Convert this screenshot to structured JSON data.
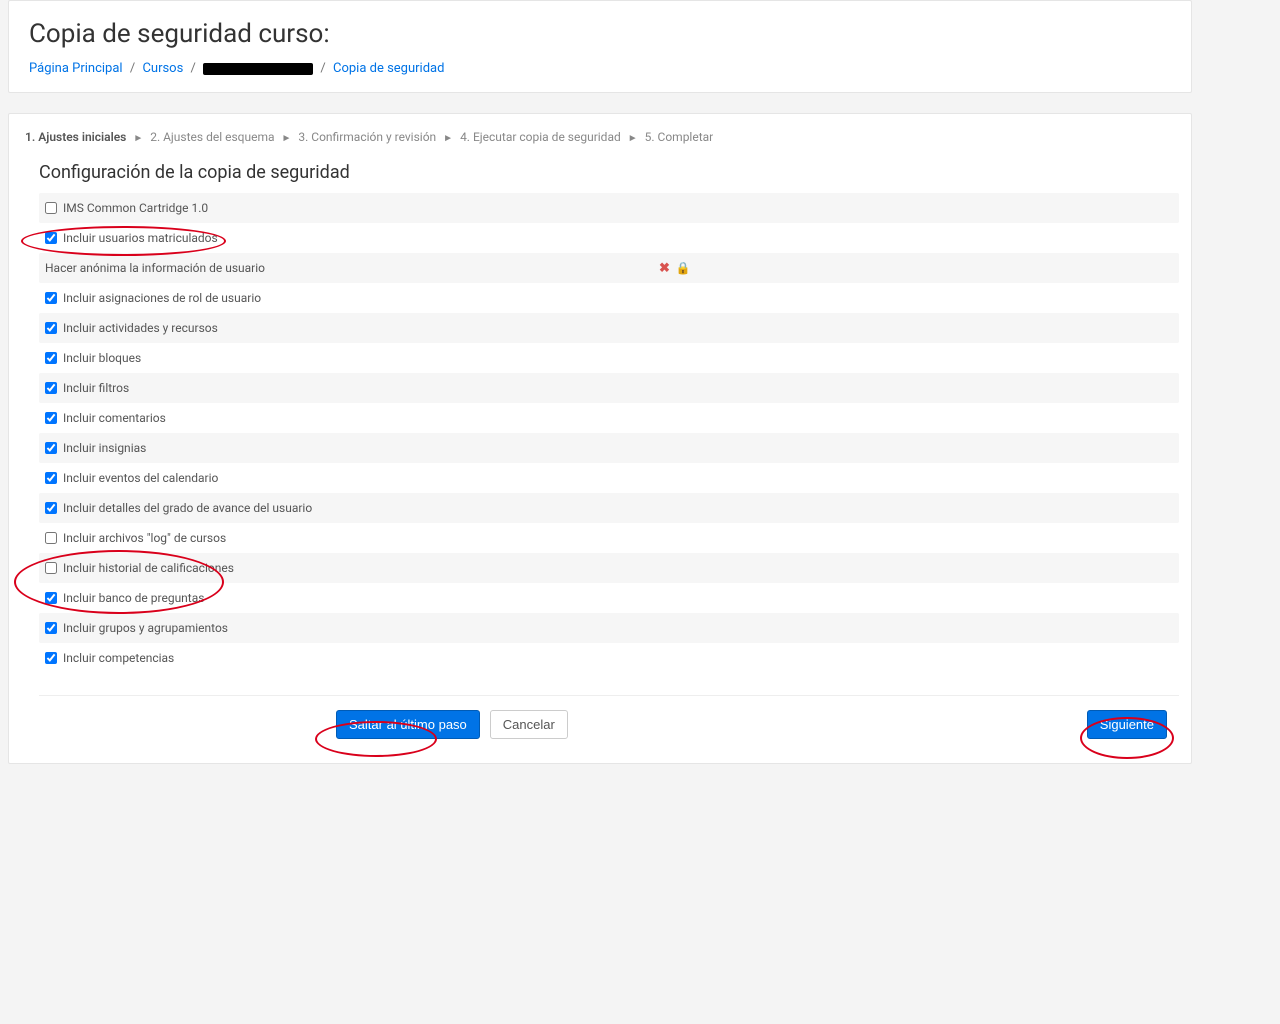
{
  "header": {
    "title": "Copia de seguridad curso:"
  },
  "breadcrumb": {
    "home": "Página Principal",
    "courses": "Cursos",
    "current": "Copia de seguridad"
  },
  "stepper": {
    "steps": [
      "1. Ajustes iniciales",
      "2. Ajustes del esquema",
      "3. Confirmación y revisión",
      "4. Ejecutar copia de seguridad",
      "5. Completar"
    ],
    "active_index": 0
  },
  "section": {
    "title": "Configuración de la copia de seguridad"
  },
  "settings": [
    {
      "label": "IMS Common Cartridge 1.0",
      "checked": false,
      "locked": false
    },
    {
      "label": "Incluir usuarios matriculados",
      "checked": true,
      "locked": false
    },
    {
      "label": "Hacer anónima la información de usuario",
      "checked": null,
      "locked": true
    },
    {
      "label": "Incluir asignaciones de rol de usuario",
      "checked": true,
      "locked": false
    },
    {
      "label": "Incluir actividades y recursos",
      "checked": true,
      "locked": false
    },
    {
      "label": "Incluir bloques",
      "checked": true,
      "locked": false
    },
    {
      "label": "Incluir filtros",
      "checked": true,
      "locked": false
    },
    {
      "label": "Incluir comentarios",
      "checked": true,
      "locked": false
    },
    {
      "label": "Incluir insignias",
      "checked": true,
      "locked": false
    },
    {
      "label": "Incluir eventos del calendario",
      "checked": true,
      "locked": false
    },
    {
      "label": "Incluir detalles del grado de avance del usuario",
      "checked": true,
      "locked": false
    },
    {
      "label": "Incluir archivos \"log\" de cursos",
      "checked": false,
      "locked": false
    },
    {
      "label": "Incluir historial de calificaciones",
      "checked": false,
      "locked": false
    },
    {
      "label": "Incluir banco de preguntas",
      "checked": true,
      "locked": false
    },
    {
      "label": "Incluir grupos y agrupamientos",
      "checked": true,
      "locked": false
    },
    {
      "label": "Incluir competencias",
      "checked": true,
      "locked": false
    }
  ],
  "buttons": {
    "skip": "Saltar al último paso",
    "cancel": "Cancelar",
    "next": "Siguiente"
  }
}
